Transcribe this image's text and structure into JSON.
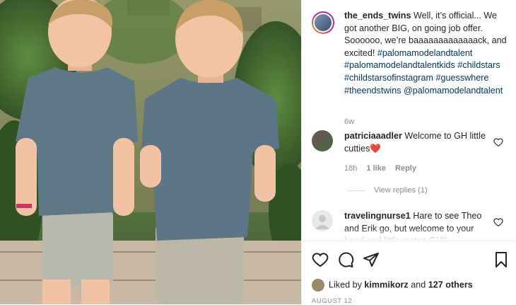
{
  "post": {
    "username": "the_ends_twins",
    "caption_line1": "Well, it’s official... We got another BIG, on going job offer. Soooooo, we’re baaaaaaaaaaaaack, and excited! ",
    "hashtags": [
      "#palomamodelandtalent",
      "#palomamodelandtalentkids",
      "#childstars",
      "#childstarsofinstagram",
      "#guesswhere",
      "#theendstwins",
      "@palomamodelandtalent"
    ],
    "time_ago": "6w"
  },
  "comments": [
    {
      "username": "patriciaaadler",
      "text": "Welcome to GH little cutties",
      "emoji": "❤️",
      "time": "18h",
      "likes": "1 like",
      "reply": "Reply",
      "view_replies": "View replies (1)"
    },
    {
      "username": "travelingnurse1",
      "text": "Hare to see Theo and Erik go, but welcome to your hood and little mates GH!!"
    }
  ],
  "likes": {
    "prefix": "Liked by",
    "user": "kimmikorz",
    "and": "and",
    "others": "127 others"
  },
  "date": "AUGUST 12"
}
